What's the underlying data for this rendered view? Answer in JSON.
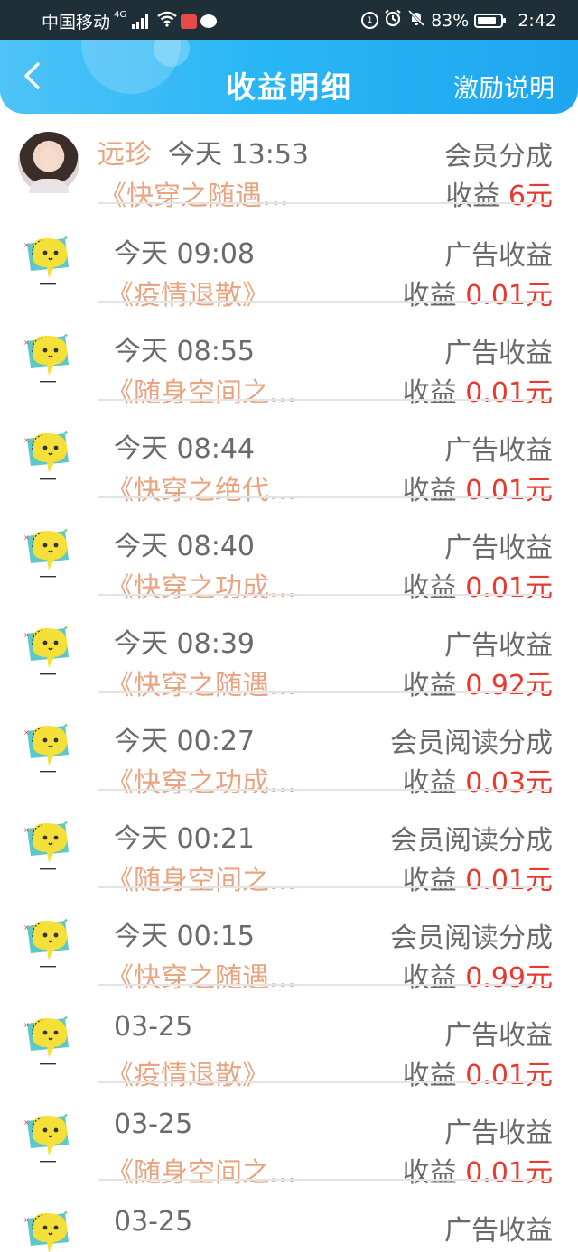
{
  "status_bar": {
    "carrier": "中国移动",
    "network_tag": "4G",
    "battery": "83%",
    "battery_level": 0.83,
    "clock": "2:42"
  },
  "header": {
    "title": "收益明细",
    "right_link": "激励说明",
    "back_icon": "chevron-left-icon"
  },
  "income_label": "收益",
  "records": [
    {
      "kind": "member",
      "name": "远珍",
      "time": "今天 13:53",
      "book": "《快穿之随遇…",
      "type": "会员分成",
      "amount": "6元"
    },
    {
      "kind": "ad",
      "time": "今天 09:08",
      "book": "《疫情退散》",
      "type": "广告收益",
      "amount": "0.01元"
    },
    {
      "kind": "ad",
      "time": "今天 08:55",
      "book": "《随身空间之…",
      "type": "广告收益",
      "amount": "0.01元"
    },
    {
      "kind": "ad",
      "time": "今天 08:44",
      "book": "《快穿之绝代…",
      "type": "广告收益",
      "amount": "0.01元"
    },
    {
      "kind": "ad",
      "time": "今天 08:40",
      "book": "《快穿之功成…",
      "type": "广告收益",
      "amount": "0.01元"
    },
    {
      "kind": "ad",
      "time": "今天 08:39",
      "book": "《快穿之随遇…",
      "type": "广告收益",
      "amount": "0.92元"
    },
    {
      "kind": "ad",
      "time": "今天 00:27",
      "book": "《快穿之功成…",
      "type": "会员阅读分成",
      "amount": "0.03元"
    },
    {
      "kind": "ad",
      "time": "今天 00:21",
      "book": "《随身空间之…",
      "type": "会员阅读分成",
      "amount": "0.01元"
    },
    {
      "kind": "ad",
      "time": "今天 00:15",
      "book": "《快穿之随遇…",
      "type": "会员阅读分成",
      "amount": "0.99元"
    },
    {
      "kind": "ad",
      "time": "03-25",
      "book": "《疫情退散》",
      "type": "广告收益",
      "amount": "0.01元"
    },
    {
      "kind": "ad",
      "time": "03-25",
      "book": "《随身空间之…",
      "type": "广告收益",
      "amount": "0.01元"
    },
    {
      "kind": "ad",
      "time": "03-25",
      "book": "",
      "type": "广告收益",
      "amount": ""
    }
  ],
  "colors": {
    "header_gradient_start": "#4fc3f7",
    "header_gradient_end": "#1ea6ef",
    "book_title": "#e8a582",
    "amount": "#e8392e",
    "status_bar": "#1f2f37"
  }
}
